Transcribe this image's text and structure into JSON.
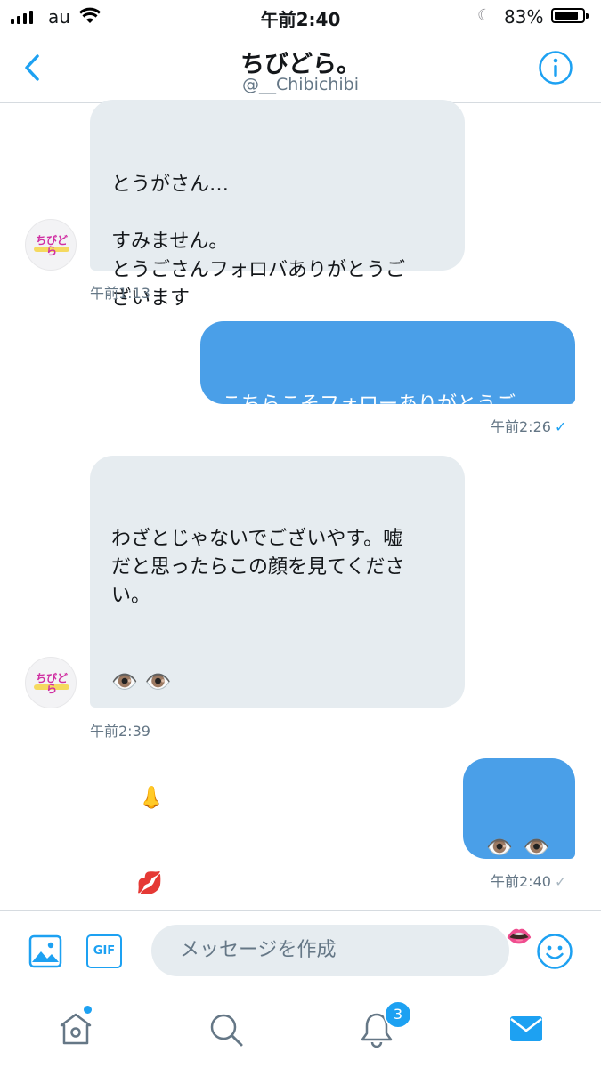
{
  "status_bar": {
    "carrier": "au",
    "time": "午前2:40",
    "battery": "83%"
  },
  "header": {
    "name": "ちびどら。",
    "handle": "@__Chibichibi"
  },
  "messages": [
    {
      "text": "とうがさん…\n\nすみません。\nとうごさんフォロバありがとうご\nざいます",
      "time": "午前1:13"
    },
    {
      "text": "こちらこそフォローありがとうご\nです(｀・ω・´)ゞ",
      "time": "午前2:26"
    },
    {
      "text": "わざとじゃないでございやす。嘘\nだと思ったらこの顔を見てくださ\nい。",
      "emoji": [
        "👁️ 👁️",
        "👃",
        "💋"
      ],
      "time": "午前2:39"
    },
    {
      "emoji": [
        "👁️ 👁️",
        "👄"
      ],
      "time": "午前2:40"
    }
  ],
  "avatar": {
    "logo_text": "ちびどら"
  },
  "composer": {
    "placeholder": "メッセージを作成",
    "gif_label": "GIF"
  },
  "tabbar": {
    "notifications_count": "3"
  },
  "colors": {
    "accent": "#1da1f2",
    "outgoing_bubble": "#4a9fe8",
    "incoming_bubble": "#e6ecf0"
  }
}
